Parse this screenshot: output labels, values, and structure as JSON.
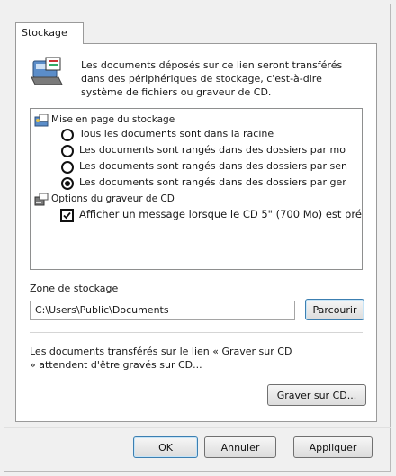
{
  "tab": {
    "label": "Stockage"
  },
  "description": "Les documents déposés sur ce lien seront transférés dans des périphériques de stockage, c'est-à-dire système de fichiers ou graveur de CD.",
  "tree": {
    "layout_header": "Mise en page du stockage",
    "options": [
      {
        "label": "Tous les documents sont dans la racine",
        "selected": false
      },
      {
        "label": "Les documents sont rangés dans des dossiers par mo",
        "selected": false
      },
      {
        "label": "Les documents sont rangés dans des dossiers par sen",
        "selected": false
      },
      {
        "label": "Les documents sont rangés dans des dossiers par ger",
        "selected": true
      }
    ],
    "cd_header": "Options du graveur de CD",
    "cd_option": {
      "label": "Afficher un message lorsque le CD 5\" (700 Mo) est pré",
      "checked": true
    }
  },
  "storage": {
    "label": "Zone de stockage",
    "path": "C:\\Users\\Public\\Documents",
    "browse_label": "Parcourir"
  },
  "burn": {
    "info": "Les documents transférés sur le lien « Graver sur CD » attendent d'être gravés sur CD...",
    "button_label": "Graver sur CD..."
  },
  "footer": {
    "ok": "OK",
    "cancel": "Annuler",
    "apply": "Appliquer"
  }
}
